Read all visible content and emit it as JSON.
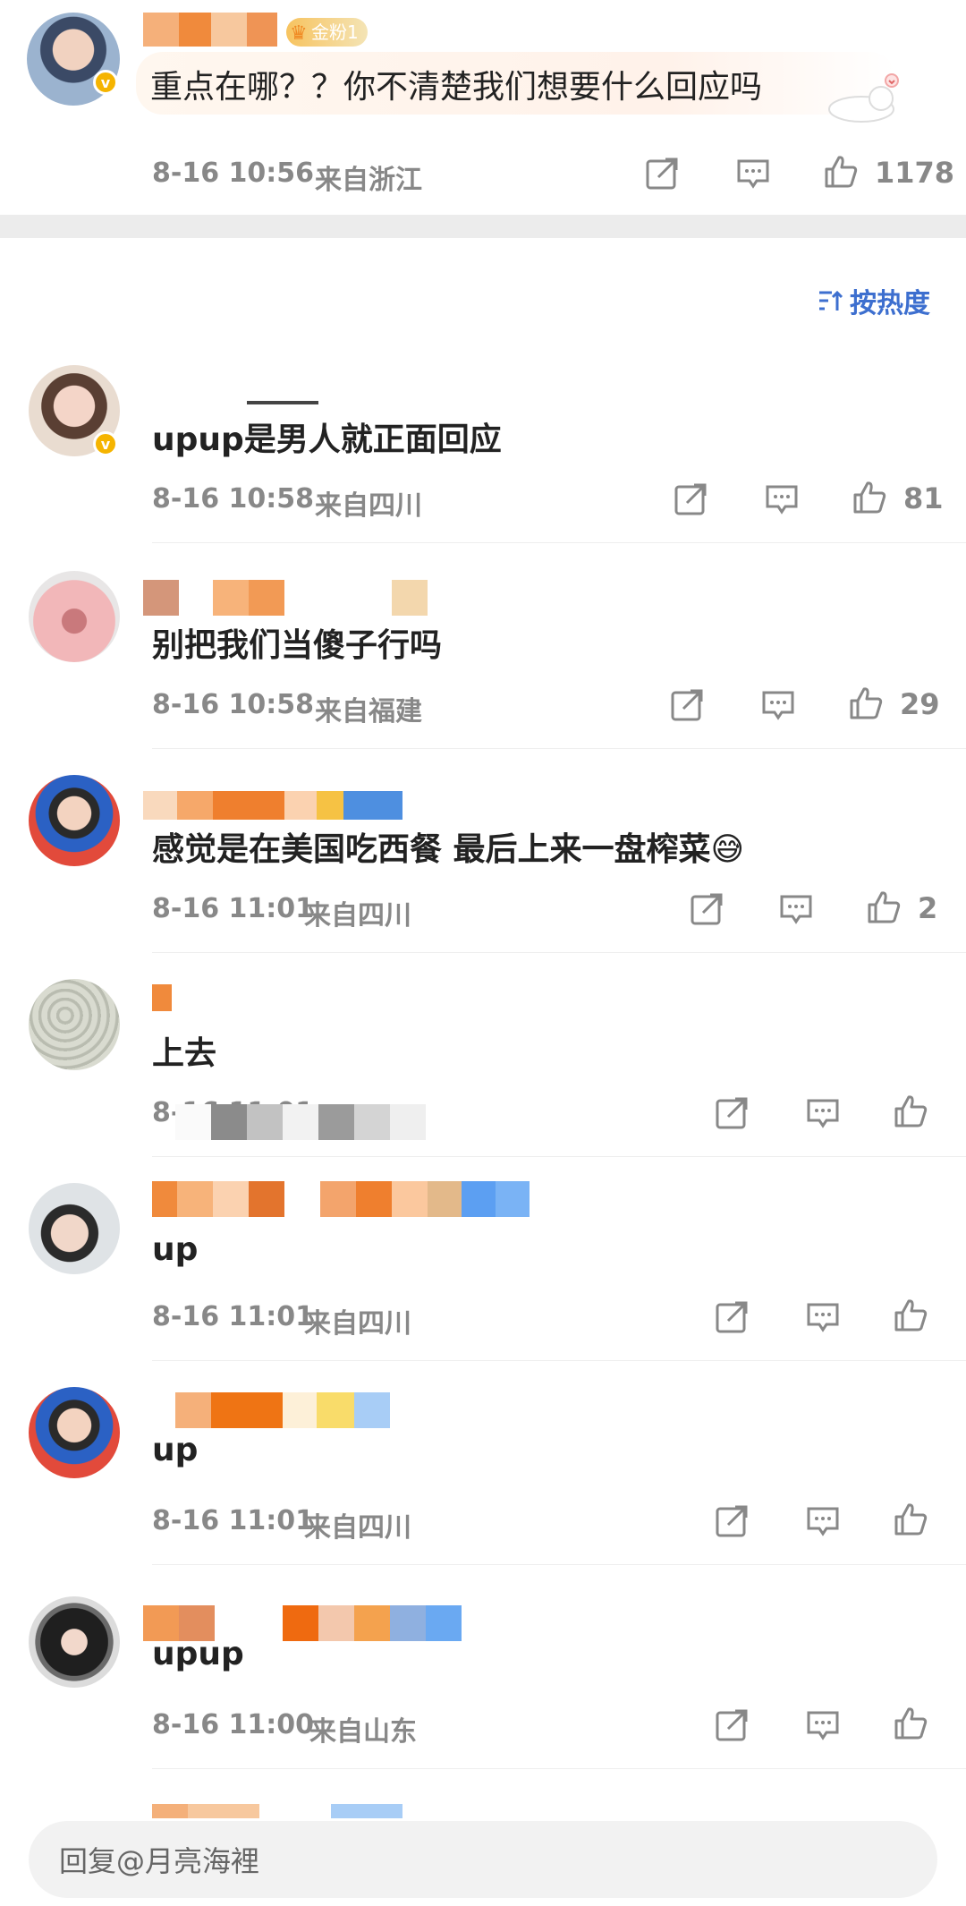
{
  "top_comment": {
    "text": "重点在哪？？你不清楚我们想要什么回应吗",
    "fan_badge": "金粉1",
    "time": "8-16 10:56",
    "location": "来自浙江",
    "likes": "1178"
  },
  "sort": {
    "label": "按热度",
    "icon": "sort-icon"
  },
  "comments": [
    {
      "text": "upup是男人就正面回应",
      "time": "8-16 10:58",
      "location": "来自四川",
      "likes": "81"
    },
    {
      "text": "别把我们当傻子行吗",
      "time": "8-16 10:58",
      "location": "来自福建",
      "likes": "29"
    },
    {
      "text": "感觉是在美国吃西餐 最后上来一盘榨菜😅",
      "time": "8-16 11:01",
      "location": "来自四川",
      "likes": "2"
    },
    {
      "text": "上去",
      "time": "8-16 11:01",
      "location": "来自福建",
      "likes": ""
    },
    {
      "text": "up",
      "time": "8-16 11:01",
      "location": "来自四川",
      "likes": ""
    },
    {
      "text": "up",
      "time": "8-16 11:01",
      "location": "来自四川",
      "likes": ""
    },
    {
      "text": "upup",
      "time": "8-16 11:00",
      "location": "来自山东",
      "likes": ""
    }
  ],
  "reply_bar": {
    "placeholder": "回复@月亮海裡"
  },
  "colors": {
    "accent": "#3d6fcf",
    "meta": "#888888",
    "divider": "#ececec"
  }
}
